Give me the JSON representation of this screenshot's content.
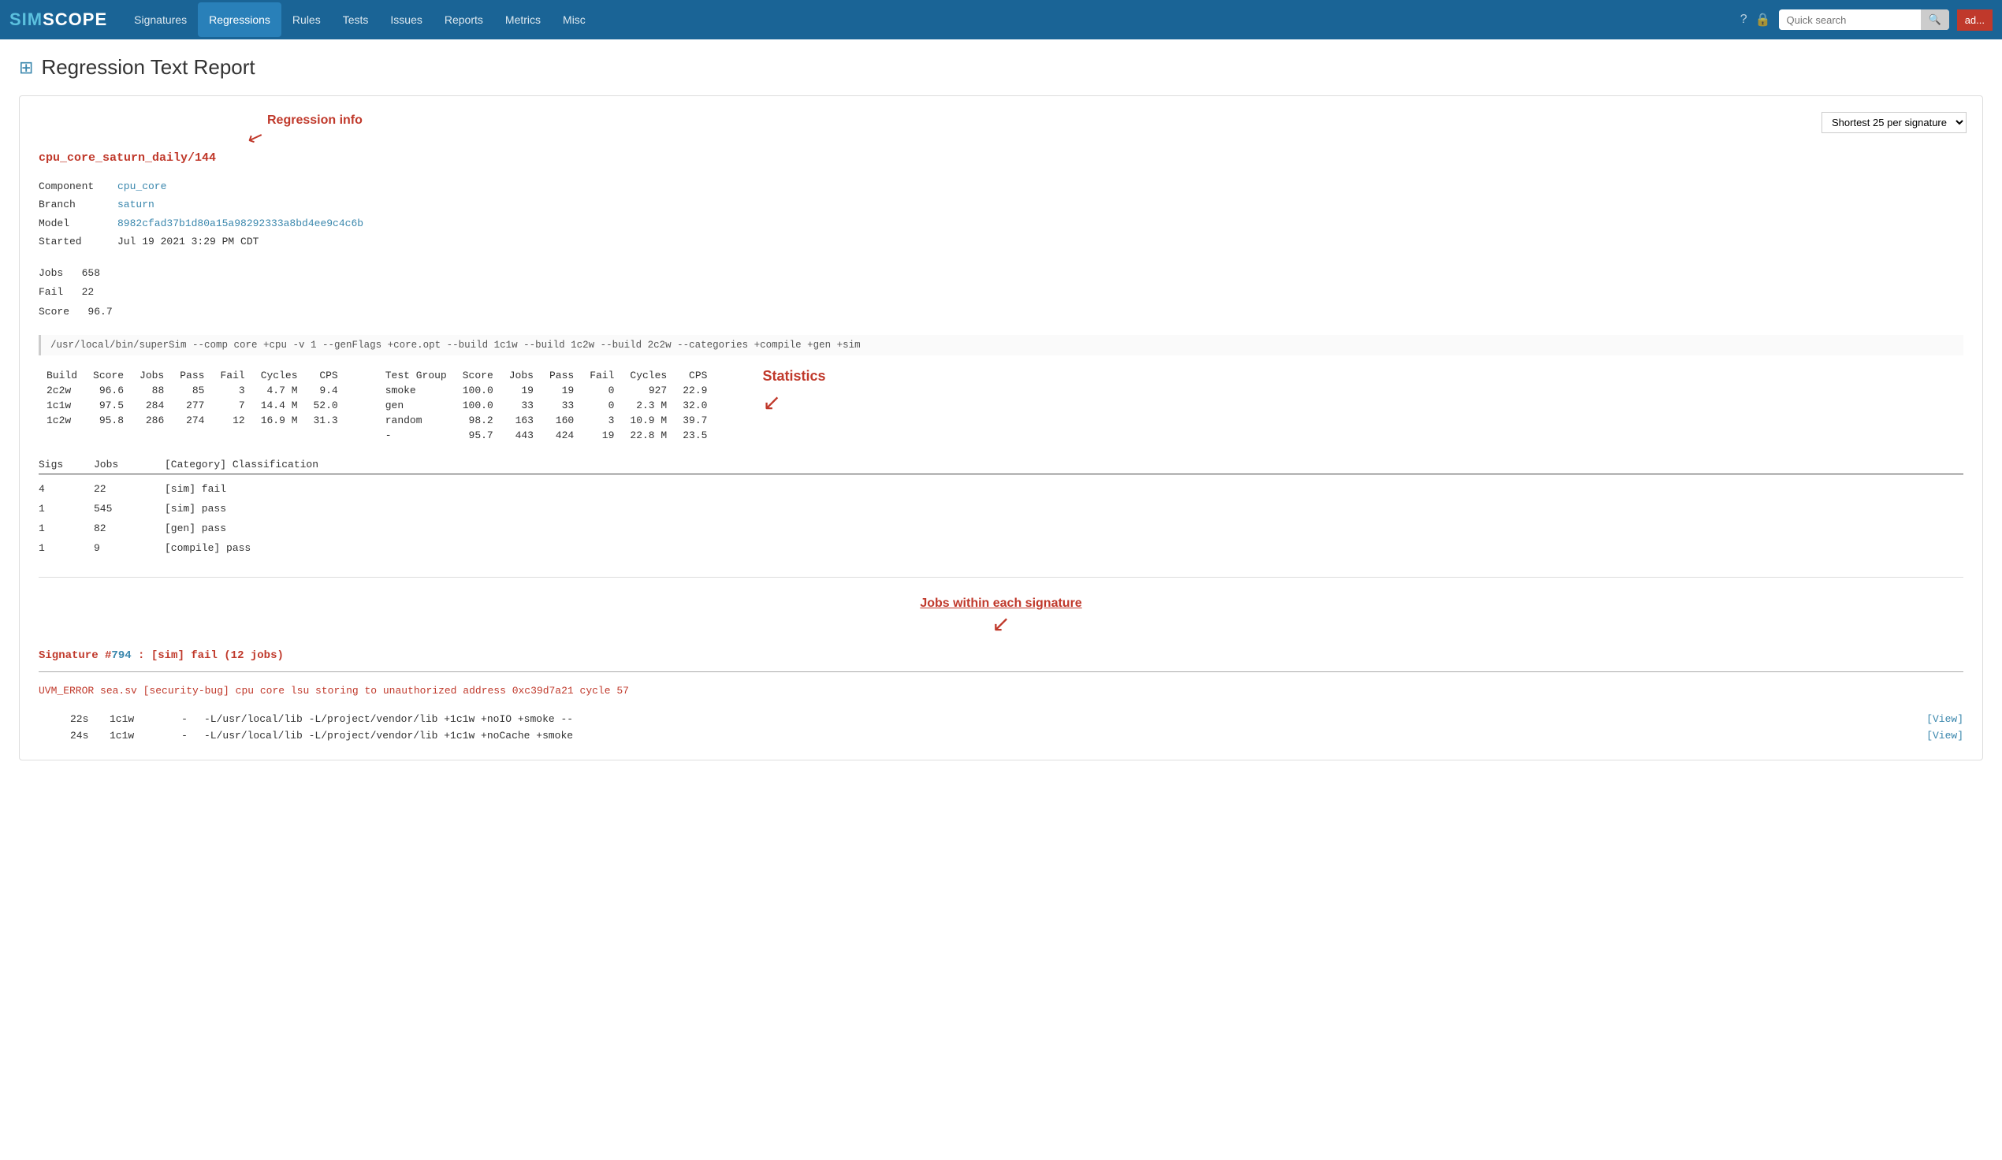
{
  "nav": {
    "logo_sim": "SIM",
    "logo_scope": "SCOPE",
    "links": [
      {
        "label": "Signatures",
        "active": false
      },
      {
        "label": "Regressions",
        "active": true
      },
      {
        "label": "Rules",
        "active": false
      },
      {
        "label": "Tests",
        "active": false
      },
      {
        "label": "Issues",
        "active": false
      },
      {
        "label": "Reports",
        "active": false
      },
      {
        "label": "Metrics",
        "active": false
      },
      {
        "label": "Misc",
        "active": false
      }
    ],
    "search_placeholder": "Quick search",
    "user_label": "ad..."
  },
  "page": {
    "title": "Regression Text Report",
    "title_icon": "⊞"
  },
  "report": {
    "annotation_regression_info": "Regression info",
    "dropdown_label": "Shortest 25 per signature",
    "regression_title": "cpu_core_saturn_daily/144",
    "component_label": "Component",
    "component_value": "cpu_core",
    "branch_label": "Branch",
    "branch_value": "saturn",
    "model_label": "Model",
    "model_value": "8982cfad37b1d80a15a98292333a8bd4ee9c4c6b",
    "started_label": "Started",
    "started_value": "Jul 19 2021 3:29 PM CDT",
    "jobs_label": "Jobs",
    "jobs_value": "658",
    "fail_label": "Fail",
    "fail_value": "22",
    "score_label": "Score",
    "score_value": "96.7",
    "cmd_line": "/usr/local/bin/superSim --comp core +cpu -v 1 --genFlags +core.opt --build 1c1w --build 1c2w --build 2c2w --categories +compile +gen +sim",
    "build_table": {
      "headers": [
        "Build",
        "Score",
        "Jobs",
        "Pass",
        "Fail",
        "Cycles",
        "CPS"
      ],
      "rows": [
        [
          "2c2w",
          "96.6",
          "88",
          "85",
          "3",
          "4.7 M",
          "9.4"
        ],
        [
          "1c1w",
          "97.5",
          "284",
          "277",
          "7",
          "14.4 M",
          "52.0"
        ],
        [
          "1c2w",
          "95.8",
          "286",
          "274",
          "12",
          "16.9 M",
          "31.3"
        ]
      ]
    },
    "test_table": {
      "headers": [
        "Test Group",
        "Score",
        "Jobs",
        "Pass",
        "Fail",
        "Cycles",
        "CPS"
      ],
      "rows": [
        [
          "smoke",
          "100.0",
          "19",
          "19",
          "0",
          "927",
          "22.9"
        ],
        [
          "gen",
          "100.0",
          "33",
          "33",
          "0",
          "2.3 M",
          "32.0"
        ],
        [
          "random",
          "98.2",
          "163",
          "160",
          "3",
          "10.9 M",
          "39.7"
        ],
        [
          "-",
          "95.7",
          "443",
          "424",
          "19",
          "22.8 M",
          "23.5"
        ]
      ]
    },
    "annotation_statistics": "Statistics",
    "sigs_table": {
      "headers": [
        "Sigs",
        "Jobs",
        "[Category] Classification"
      ],
      "rows": [
        [
          "4",
          "22",
          "[sim] fail"
        ],
        [
          "1",
          "545",
          "[sim] pass"
        ],
        [
          "1",
          "82",
          "[gen] pass"
        ],
        [
          "1",
          "9",
          "[compile] pass"
        ]
      ]
    },
    "annotation_jobs": "Jobs within each signature",
    "signature_title_pre": "Signature #",
    "signature_number": "794",
    "signature_title_post": " : [sim] fail  (12 jobs)",
    "error_line": "UVM_ERROR sea.sv [security-bug] cpu core lsu storing to unauthorized address 0xc39d7a21 cycle 57",
    "job_rows": [
      {
        "time": "22s",
        "build": "1c1w",
        "dash": "-",
        "cmd": "-L/usr/local/lib -L/project/vendor/lib +1c1w +noIO +smoke --",
        "view": "[View]"
      },
      {
        "time": "24s",
        "build": "1c1w",
        "dash": "-",
        "cmd": "-L/usr/local/lib -L/project/vendor/lib +1c1w +noCache +smoke",
        "view": "[View]"
      }
    ]
  }
}
